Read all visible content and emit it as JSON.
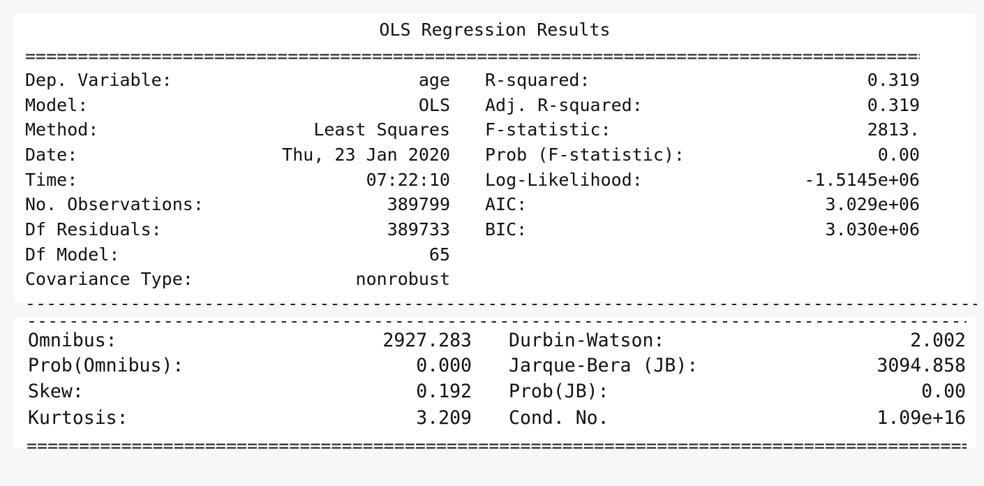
{
  "title": "OLS Regression Results",
  "separators": {
    "double": "=============================================================================================================================",
    "single": "-----------------------------------------------------------------------------------------------------------------------------"
  },
  "model_summary": {
    "left": [
      {
        "label": "Dep. Variable:",
        "value": "age"
      },
      {
        "label": "Model:",
        "value": "OLS"
      },
      {
        "label": "Method:",
        "value": "Least Squares"
      },
      {
        "label": "Date:",
        "value": "Thu, 23 Jan 2020"
      },
      {
        "label": "Time:",
        "value": "07:22:10"
      },
      {
        "label": "No. Observations:",
        "value": "389799"
      },
      {
        "label": "Df Residuals:",
        "value": "389733"
      },
      {
        "label": "Df Model:",
        "value": "65"
      },
      {
        "label": "Covariance Type:",
        "value": "nonrobust"
      }
    ],
    "right": [
      {
        "label": "R-squared:",
        "value": "0.319"
      },
      {
        "label": "Adj. R-squared:",
        "value": "0.319"
      },
      {
        "label": "F-statistic:",
        "value": "2813."
      },
      {
        "label": "Prob (F-statistic):",
        "value": "0.00"
      },
      {
        "label": "Log-Likelihood:",
        "value": "-1.5145e+06"
      },
      {
        "label": "AIC:",
        "value": "3.029e+06"
      },
      {
        "label": "BIC:",
        "value": "3.030e+06"
      }
    ]
  },
  "diagnostics": {
    "left": [
      {
        "label": "Omnibus:",
        "value": "2927.283"
      },
      {
        "label": "Prob(Omnibus):",
        "value": "0.000"
      },
      {
        "label": "Skew:",
        "value": "0.192"
      },
      {
        "label": "Kurtosis:",
        "value": "3.209"
      }
    ],
    "right": [
      {
        "label": "Durbin-Watson:",
        "value": "2.002"
      },
      {
        "label": "Jarque-Bera (JB):",
        "value": "3094.858"
      },
      {
        "label": "Prob(JB):",
        "value": "0.00"
      },
      {
        "label": "Cond. No.",
        "value": "1.09e+16"
      }
    ]
  }
}
